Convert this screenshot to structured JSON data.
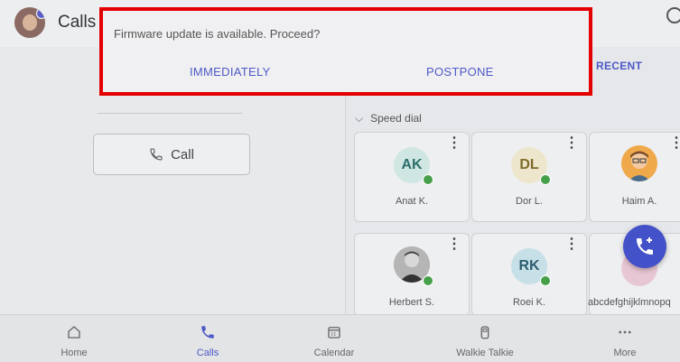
{
  "header": {
    "title": "Calls"
  },
  "dialog": {
    "message": "Firmware update is available. Proceed?",
    "button_immediately": "IMMEDIATELY",
    "button_postpone": "POSTPONE"
  },
  "tabs": {
    "recent_label": "RECENT"
  },
  "left": {
    "call_button_label": "Call"
  },
  "speed_dial": {
    "section_label": "Speed dial",
    "contacts": [
      {
        "initials": "AK",
        "name": "Anat K.",
        "color": "#cfe6e3",
        "text_color": "#2d6e6b"
      },
      {
        "initials": "DL",
        "name": "Dor L.",
        "color": "#eee6cc",
        "text_color": "#7d6a2b"
      },
      {
        "initials": "",
        "name": "Haim A.",
        "color": "#f0a94a",
        "text_color": "#333"
      },
      {
        "initials": "",
        "name": "Herbert S.",
        "color": "#777",
        "text_color": "#fff"
      },
      {
        "initials": "RK",
        "name": "Roei K.",
        "color": "#c7e0e8",
        "text_color": "#2d5d6e"
      },
      {
        "initials": "",
        "name": "abcdefghijklmnopq",
        "color": "#e8c7d5",
        "text_color": "#333"
      }
    ]
  },
  "nav": {
    "items": [
      {
        "label": "Home"
      },
      {
        "label": "Calls"
      },
      {
        "label": "Calendar"
      },
      {
        "label": "Walkie Talkie"
      },
      {
        "label": "More"
      }
    ]
  },
  "colors": {
    "accent": "#4d59c7",
    "fab": "#4352c8",
    "highlight_border": "#e30000",
    "presence_available": "#45a049"
  }
}
